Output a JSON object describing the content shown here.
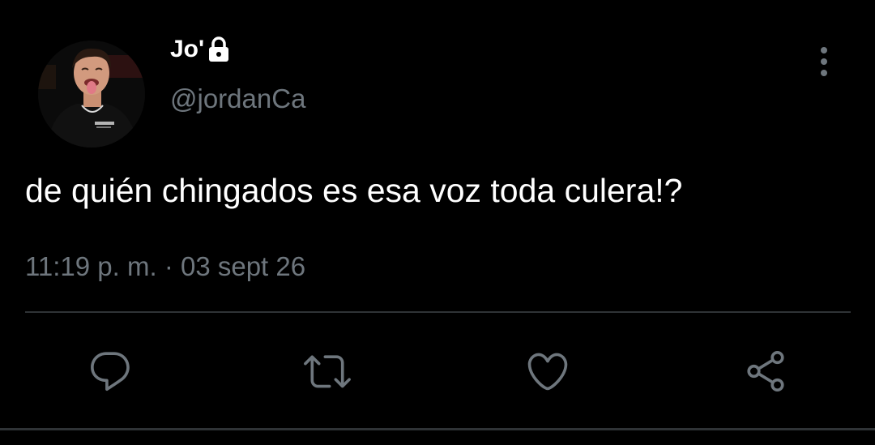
{
  "tweet": {
    "display_name": "Jo'",
    "username": "@jordanCa",
    "text": "de quién chingados es esa voz toda culera!?",
    "timestamp": "11:19 p. m. · 03 sept 26",
    "protected": true
  },
  "actions": {
    "reply_icon": "reply-icon",
    "retweet_icon": "retweet-icon",
    "like_icon": "heart-icon",
    "share_icon": "share-icon"
  },
  "colors": {
    "background": "#000000",
    "text_primary": "#ffffff",
    "text_secondary": "#6e767d",
    "divider": "#2f3336",
    "icon": "#6e767d"
  }
}
